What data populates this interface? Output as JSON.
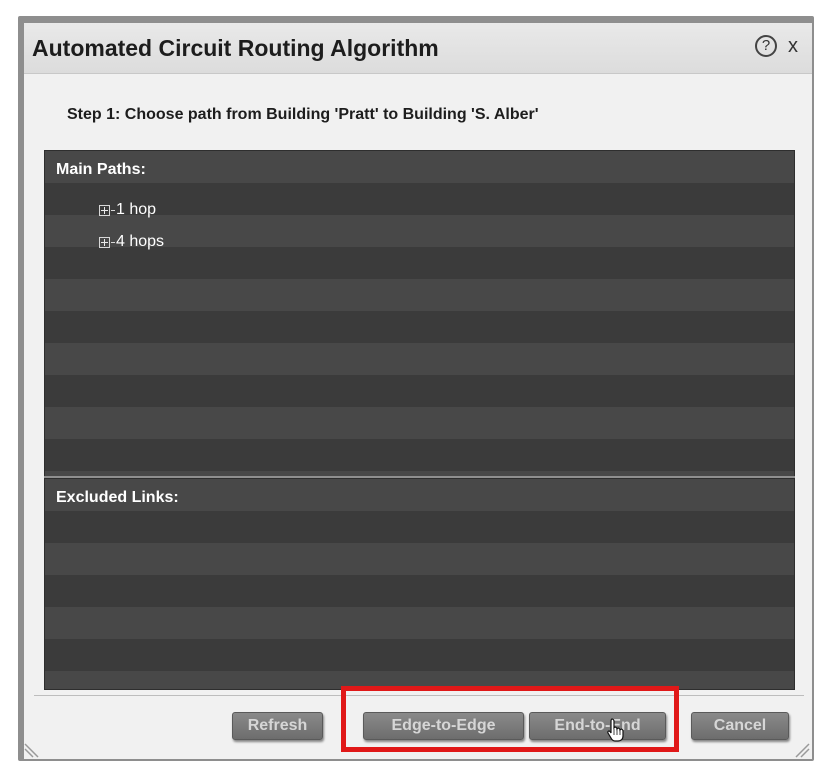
{
  "dialog": {
    "title": "Automated Circuit Routing Algorithm",
    "help_icon": "?",
    "close_icon": "x"
  },
  "step": {
    "label": "Step 1: Choose path from Building 'Pratt' to Building 'S. Alber'"
  },
  "main_paths": {
    "header": "Main Paths:",
    "items": [
      {
        "label": "1 hop",
        "icon": "expand-plus-icon"
      },
      {
        "label": "4 hops",
        "icon": "expand-plus-icon"
      }
    ]
  },
  "excluded_links": {
    "header": "Excluded Links:"
  },
  "buttons": {
    "refresh": "Refresh",
    "edge_to_edge": "Edge-to-Edge",
    "end_to_end": "End-to-End",
    "cancel": "Cancel"
  },
  "colors": {
    "panel_dark": "#3b3b3b",
    "panel_light": "#484848",
    "highlight": "#e01818",
    "button": "#7a7a7a"
  }
}
